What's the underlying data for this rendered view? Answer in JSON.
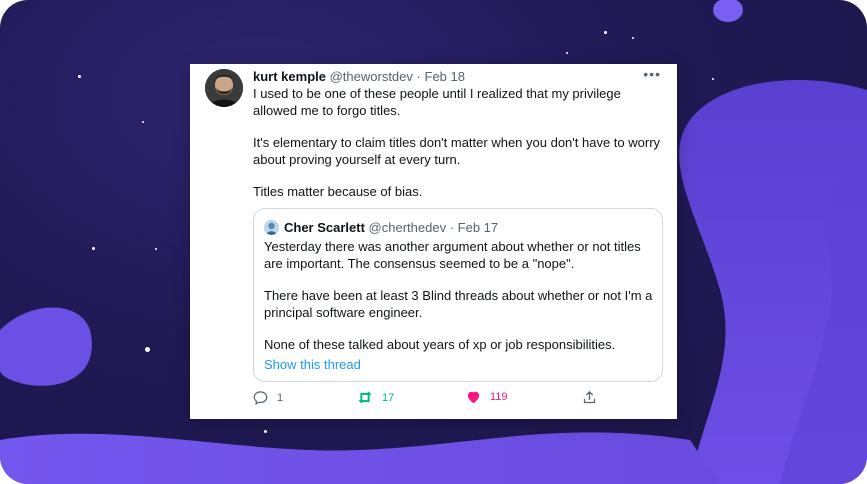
{
  "tweet": {
    "author_name": "kurt kemple",
    "author_handle": "@theworstdev",
    "separator": "·",
    "date": "Feb 18",
    "more_label": "•••",
    "paragraphs": [
      "I used to be one of these people until I realized that my privilege allowed me to forgo titles.",
      "It's elementary to claim titles don't matter when you don't have to worry about proving yourself at every turn.",
      "Titles matter because of bias."
    ],
    "quoted": {
      "author_name": "Cher Scarlett",
      "author_handle": "@cherthedev",
      "separator": "·",
      "date": "Feb 17",
      "paragraphs": [
        "Yesterday there was another argument about whether or not titles are important. The consensus seemed to be a \"nope\".",
        "There have been at least 3 Blind threads about whether or not I'm a principal software engineer.",
        "None of these talked about years of xp or job responsibilities."
      ],
      "thread_link": "Show this thread"
    },
    "actions": {
      "replies": "1",
      "retweets": "17",
      "likes": "119"
    }
  },
  "icons": {
    "reply": "reply-icon",
    "retweet": "retweet-icon",
    "like": "heart-icon",
    "share": "share-icon",
    "more": "more-dots-icon"
  },
  "colors": {
    "background": "#201a55",
    "blob": "#6f4fe0",
    "link": "#1d9bf0",
    "retweet": "#00ba7c",
    "like": "#f91880"
  }
}
